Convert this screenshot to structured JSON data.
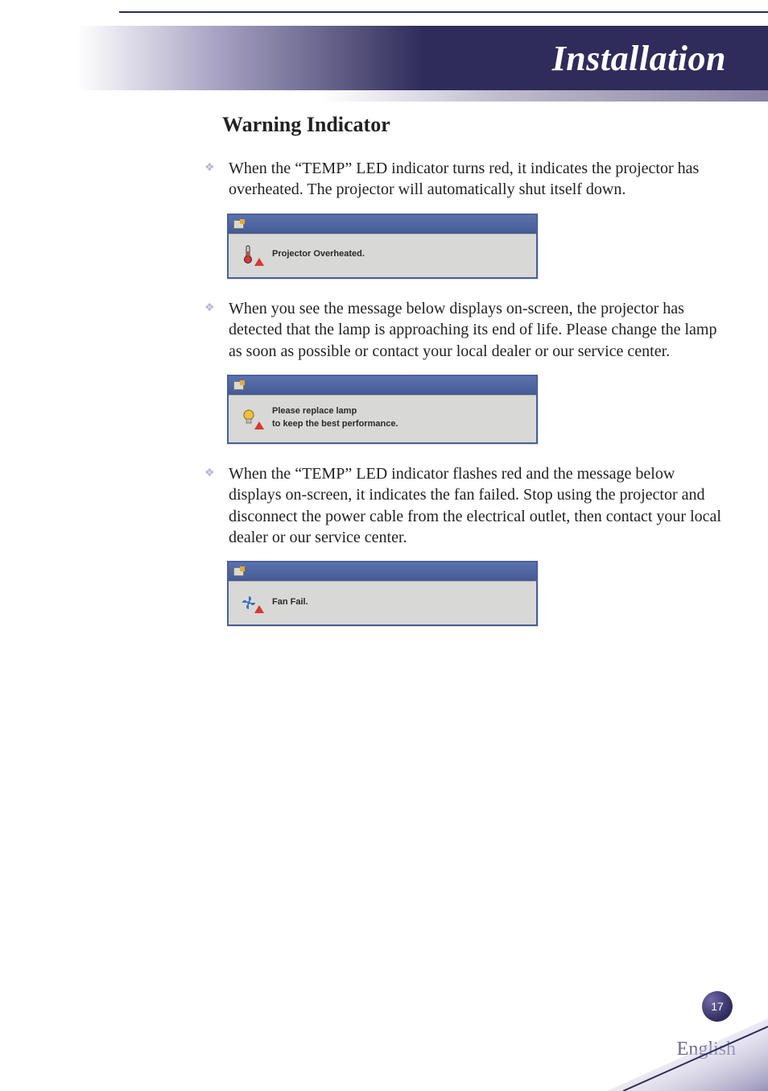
{
  "header": {
    "title": "Installation"
  },
  "section": {
    "title": "Warning Indicator"
  },
  "bullets": [
    {
      "text": "When the “TEMP” LED indicator turns red, it indicates the projector has overheated. The projector will automatically shut itself down."
    },
    {
      "text": "When you see the message below displays on-screen, the projector has detected that the lamp is approaching its end of life. Please change the lamp as soon as possible or contact your local dealer or our service center."
    },
    {
      "text": "When the “TEMP” LED indicator flashes red and the message below displays on-screen, it indicates the fan failed. Stop using the projector and disconnect the power cable from the electrical outlet, then contact your local dealer or our service center."
    }
  ],
  "warnings": [
    {
      "line1": "Projector Overheated.",
      "line2": ""
    },
    {
      "line1": "Please replace lamp",
      "line2": "to keep the best performance."
    },
    {
      "line1": "Fan Fail.",
      "line2": ""
    }
  ],
  "footer": {
    "language": "English",
    "page": "17"
  }
}
